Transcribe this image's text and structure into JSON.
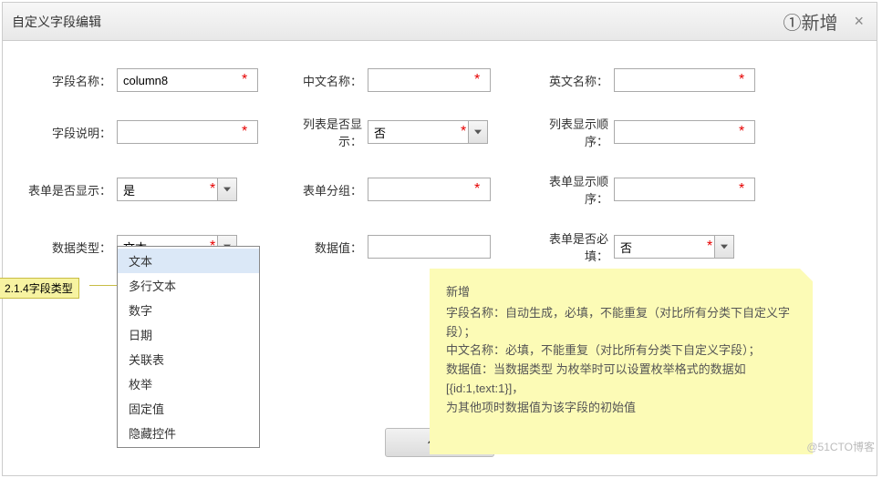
{
  "dialog": {
    "title": "自定义字段编辑",
    "header_tag": "①新增",
    "close": "×"
  },
  "fields": {
    "field_name": {
      "label": "字段名称：",
      "value": "column8"
    },
    "cn_name": {
      "label": "中文名称：",
      "value": ""
    },
    "en_name": {
      "label": "英文名称：",
      "value": ""
    },
    "field_desc": {
      "label": "字段说明：",
      "value": ""
    },
    "list_show": {
      "label": "列表是否显示：",
      "value": "否"
    },
    "list_order": {
      "label": "列表显示顺序：",
      "value": ""
    },
    "form_show": {
      "label": "表单是否显示：",
      "value": "是"
    },
    "form_group": {
      "label": "表单分组：",
      "value": ""
    },
    "form_order": {
      "label": "表单显示顺序：",
      "value": ""
    },
    "data_type": {
      "label": "数据类型：",
      "value": "文本"
    },
    "data_value": {
      "label": "数据值：",
      "value": ""
    },
    "form_required": {
      "label": "表单是否必填：",
      "value": "否"
    }
  },
  "dropdown": {
    "options": [
      "文本",
      "多行文本",
      "数字",
      "日期",
      "关联表",
      "枚举",
      "固定值",
      "隐藏控件"
    ]
  },
  "annotation": "2.1.4字段类型",
  "help": {
    "title": "新增",
    "l1": "字段名称：自动生成，必填，不能重复（对比所有分类下自定义字段）；",
    "l2": "中文名称：必填，不能重复（对比所有分类下自定义字段）；",
    "l3": "数据值：当数据类型 为枚举时可以设置枚举格式的数据如[{id:1,text:1}]，",
    "l4": "为其他项时数据值为该字段的初始值"
  },
  "buttons": {
    "save": "保存"
  },
  "watermark": "@51CTO博客"
}
